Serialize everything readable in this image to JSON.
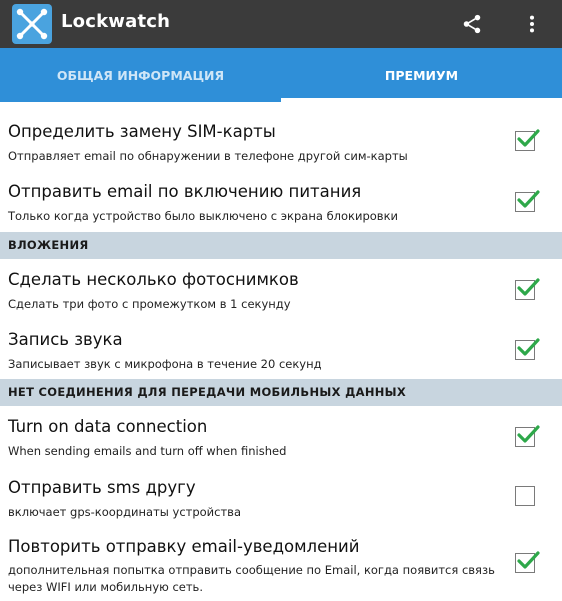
{
  "app": {
    "title": "Lockwatch",
    "brand_color": "#4aa3df",
    "appbar_color": "#3b3b3b",
    "tab_color": "#2f8fd8"
  },
  "tabs": [
    {
      "label": "ОБЩАЯ ИНФОРМАЦИЯ",
      "selected": false
    },
    {
      "label": "ПРЕМИУМ",
      "selected": true
    }
  ],
  "settings": [
    {
      "title": "Определить замену SIM-карты",
      "subtitle": "Отправляет email по обнаружении в телефоне другой сим-карты",
      "checked": true
    },
    {
      "title": "Отправить email по включению питания",
      "subtitle": "Только когда устройство было выключено с экрана блокировки",
      "checked": true
    }
  ],
  "sections": [
    {
      "header": "ВЛОЖЕНИЯ",
      "items": [
        {
          "title": "Сделать несколько фотоснимков",
          "subtitle": "Сделать три фото с промежутком в 1 секунду",
          "checked": true
        },
        {
          "title": "Запись звука",
          "subtitle": "Записывает звук с микрофона в течение 20 секунд",
          "checked": true
        }
      ]
    },
    {
      "header": "НЕТ СОЕДИНЕНИЯ ДЛЯ ПЕРЕДАЧИ МОБИЛЬНЫХ ДАННЫХ",
      "items": [
        {
          "title": "Turn on data connection",
          "subtitle": "When sending emails and turn off when finished",
          "checked": true
        },
        {
          "title": "Отправить sms другу",
          "subtitle": "включает gps-координаты устройства",
          "checked": false
        },
        {
          "title": "Повторить отправку email-уведомлений",
          "subtitle": "дополнительная попытка отправить сообщение по Email, когда появится связь через WIFI или мобильную сеть.",
          "checked": true
        }
      ]
    }
  ],
  "icons": {
    "app": "lockwatch-logo-icon",
    "share": "share-icon",
    "more": "more-vert-icon",
    "check": "checkmark-icon"
  },
  "check_color": "#2ea84a"
}
